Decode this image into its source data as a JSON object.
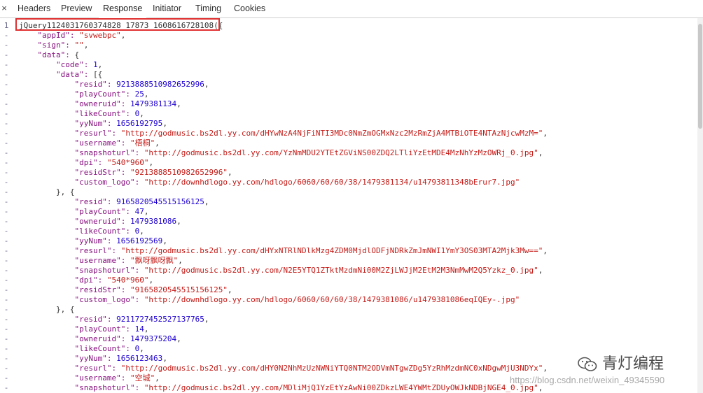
{
  "tabs": {
    "close_glyph": "×",
    "items": [
      {
        "label": "Headers"
      },
      {
        "label": "Preview"
      },
      {
        "label": "Response"
      },
      {
        "label": "Initiator"
      },
      {
        "label": "Timing"
      },
      {
        "label": "Cookies"
      }
    ],
    "active": "Response"
  },
  "gutter": [
    "1",
    "-",
    "-",
    "-",
    "-",
    "-",
    "-",
    "-",
    "-",
    "-",
    "-",
    "-",
    "-",
    "-",
    "-",
    "-",
    "-",
    "-",
    "-",
    "-",
    "-",
    "-",
    "-",
    "-",
    "-",
    "-",
    "-",
    "-",
    "-",
    "-",
    "-",
    "-",
    "-",
    "-",
    "-",
    "-",
    "-",
    "-",
    "-"
  ],
  "code_lines": [
    [
      {
        "t": "jQuery1124031760374828 17873_1608616728108({",
        "c": "p"
      }
    ],
    [
      {
        "t": "    \"appId\": ",
        "c": "k"
      },
      {
        "t": "\"svwebpc\"",
        "c": "s"
      },
      {
        "t": ",",
        "c": "p"
      }
    ],
    [
      {
        "t": "    \"sign\": ",
        "c": "k"
      },
      {
        "t": "\"\"",
        "c": "s"
      },
      {
        "t": ",",
        "c": "p"
      }
    ],
    [
      {
        "t": "    \"data\": ",
        "c": "k"
      },
      {
        "t": "{",
        "c": "p"
      }
    ],
    [
      {
        "t": "        \"code\": ",
        "c": "k"
      },
      {
        "t": "1",
        "c": "n"
      },
      {
        "t": ",",
        "c": "p"
      }
    ],
    [
      {
        "t": "        \"data\": ",
        "c": "k"
      },
      {
        "t": "[{",
        "c": "p"
      }
    ],
    [
      {
        "t": "            \"resid\": ",
        "c": "k"
      },
      {
        "t": "9213888510982652996",
        "c": "n"
      },
      {
        "t": ",",
        "c": "p"
      }
    ],
    [
      {
        "t": "            \"playCount\": ",
        "c": "k"
      },
      {
        "t": "25",
        "c": "n"
      },
      {
        "t": ",",
        "c": "p"
      }
    ],
    [
      {
        "t": "            \"owneruid\": ",
        "c": "k"
      },
      {
        "t": "1479381134",
        "c": "n"
      },
      {
        "t": ",",
        "c": "p"
      }
    ],
    [
      {
        "t": "            \"likeCount\": ",
        "c": "k"
      },
      {
        "t": "0",
        "c": "n"
      },
      {
        "t": ",",
        "c": "p"
      }
    ],
    [
      {
        "t": "            \"yyNum\": ",
        "c": "k"
      },
      {
        "t": "1656192795",
        "c": "n"
      },
      {
        "t": ",",
        "c": "p"
      }
    ],
    [
      {
        "t": "            \"resurl\": ",
        "c": "k"
      },
      {
        "t": "\"http://godmusic.bs2dl.yy.com/dHYwNzA4NjFiNTI3MDc0NmZmOGMxNzc2MzRmZjA4MTBiOTE4NTAzNjcwMzM=\"",
        "c": "s"
      },
      {
        "t": ",",
        "c": "p"
      }
    ],
    [
      {
        "t": "            \"username\": ",
        "c": "k"
      },
      {
        "t": "\"梧桐\"",
        "c": "s"
      },
      {
        "t": ",",
        "c": "p"
      }
    ],
    [
      {
        "t": "            \"snapshoturl\": ",
        "c": "k"
      },
      {
        "t": "\"http://godmusic.bs2dl.yy.com/YzNmMDU2YTEtZGViNS00ZDQ2LTliYzEtMDE4MzNhYzMzOWRj_0.jpg\"",
        "c": "s"
      },
      {
        "t": ",",
        "c": "p"
      }
    ],
    [
      {
        "t": "            \"dpi\": ",
        "c": "k"
      },
      {
        "t": "\"540*960\"",
        "c": "s"
      },
      {
        "t": ",",
        "c": "p"
      }
    ],
    [
      {
        "t": "            \"residStr\": ",
        "c": "k"
      },
      {
        "t": "\"9213888510982652996\"",
        "c": "s"
      },
      {
        "t": ",",
        "c": "p"
      }
    ],
    [
      {
        "t": "            \"custom_logo\": ",
        "c": "k"
      },
      {
        "t": "\"http://downhdlogo.yy.com/hdlogo/6060/60/60/38/1479381134/u14793811348bErur7.jpg\"",
        "c": "s"
      }
    ],
    [
      {
        "t": "        }, {",
        "c": "p"
      }
    ],
    [
      {
        "t": "            \"resid\": ",
        "c": "k"
      },
      {
        "t": "9165820545515156125",
        "c": "n"
      },
      {
        "t": ",",
        "c": "p"
      }
    ],
    [
      {
        "t": "            \"playCount\": ",
        "c": "k"
      },
      {
        "t": "47",
        "c": "n"
      },
      {
        "t": ",",
        "c": "p"
      }
    ],
    [
      {
        "t": "            \"owneruid\": ",
        "c": "k"
      },
      {
        "t": "1479381086",
        "c": "n"
      },
      {
        "t": ",",
        "c": "p"
      }
    ],
    [
      {
        "t": "            \"likeCount\": ",
        "c": "k"
      },
      {
        "t": "0",
        "c": "n"
      },
      {
        "t": ",",
        "c": "p"
      }
    ],
    [
      {
        "t": "            \"yyNum\": ",
        "c": "k"
      },
      {
        "t": "1656192569",
        "c": "n"
      },
      {
        "t": ",",
        "c": "p"
      }
    ],
    [
      {
        "t": "            \"resurl\": ",
        "c": "k"
      },
      {
        "t": "\"http://godmusic.bs2dl.yy.com/dHYxNTRlNDlkMzg4ZDM0MjdlODFjNDRkZmJmNWI1YmY3OS03MTA2Mjk3Mw==\"",
        "c": "s"
      },
      {
        "t": ",",
        "c": "p"
      }
    ],
    [
      {
        "t": "            \"username\": ",
        "c": "k"
      },
      {
        "t": "\"飘呀飘呀飘\"",
        "c": "s"
      },
      {
        "t": ",",
        "c": "p"
      }
    ],
    [
      {
        "t": "            \"snapshoturl\": ",
        "c": "k"
      },
      {
        "t": "\"http://godmusic.bs2dl.yy.com/N2E5YTQ1ZTktMzdmNi00M2ZjLWJjM2EtM2M3NmMwM2Q5Yzkz_0.jpg\"",
        "c": "s"
      },
      {
        "t": ",",
        "c": "p"
      }
    ],
    [
      {
        "t": "            \"dpi\": ",
        "c": "k"
      },
      {
        "t": "\"540*960\"",
        "c": "s"
      },
      {
        "t": ",",
        "c": "p"
      }
    ],
    [
      {
        "t": "            \"residStr\": ",
        "c": "k"
      },
      {
        "t": "\"9165820545515156125\"",
        "c": "s"
      },
      {
        "t": ",",
        "c": "p"
      }
    ],
    [
      {
        "t": "            \"custom_logo\": ",
        "c": "k"
      },
      {
        "t": "\"http://downhdlogo.yy.com/hdlogo/6060/60/60/38/1479381086/u1479381086eqIQEy-.jpg\"",
        "c": "s"
      }
    ],
    [
      {
        "t": "        }, {",
        "c": "p"
      }
    ],
    [
      {
        "t": "            \"resid\": ",
        "c": "k"
      },
      {
        "t": "9211727452527137765",
        "c": "n"
      },
      {
        "t": ",",
        "c": "p"
      }
    ],
    [
      {
        "t": "            \"playCount\": ",
        "c": "k"
      },
      {
        "t": "14",
        "c": "n"
      },
      {
        "t": ",",
        "c": "p"
      }
    ],
    [
      {
        "t": "            \"owneruid\": ",
        "c": "k"
      },
      {
        "t": "1479375204",
        "c": "n"
      },
      {
        "t": ",",
        "c": "p"
      }
    ],
    [
      {
        "t": "            \"likeCount\": ",
        "c": "k"
      },
      {
        "t": "0",
        "c": "n"
      },
      {
        "t": ",",
        "c": "p"
      }
    ],
    [
      {
        "t": "            \"yyNum\": ",
        "c": "k"
      },
      {
        "t": "1656123463",
        "c": "n"
      },
      {
        "t": ",",
        "c": "p"
      }
    ],
    [
      {
        "t": "            \"resurl\": ",
        "c": "k"
      },
      {
        "t": "\"http://godmusic.bs2dl.yy.com/dHY0N2NhMzUzNWNiYTQ0NTM2ODVmNTgwZDg5YzRhMzdmNC0xNDgwMjU3NDYx\"",
        "c": "s"
      },
      {
        "t": ",",
        "c": "p"
      }
    ],
    [
      {
        "t": "            \"username\": ",
        "c": "k"
      },
      {
        "t": "\"空城\"",
        "c": "s"
      },
      {
        "t": ",",
        "c": "p"
      }
    ],
    [
      {
        "t": "            \"snapshoturl\": ",
        "c": "k"
      },
      {
        "t": "\"http://godmusic.bs2dl.yy.com/MDliMjQ1YzEtYzAwNi00ZDkzLWE4YWMtZDUyOWJkNDBjNGE4_0.jpg\"",
        "c": "s"
      },
      {
        "t": ",",
        "c": "p"
      }
    ]
  ],
  "watermark": {
    "icon": "wechat-icon",
    "text": "青灯编程"
  },
  "csdn_watermark": "https://blog.csdn.net/weixin_49345590",
  "colors": {
    "key": "#881280",
    "string": "#c41a16",
    "number": "#1c00cf",
    "highlight": "#e03030"
  }
}
